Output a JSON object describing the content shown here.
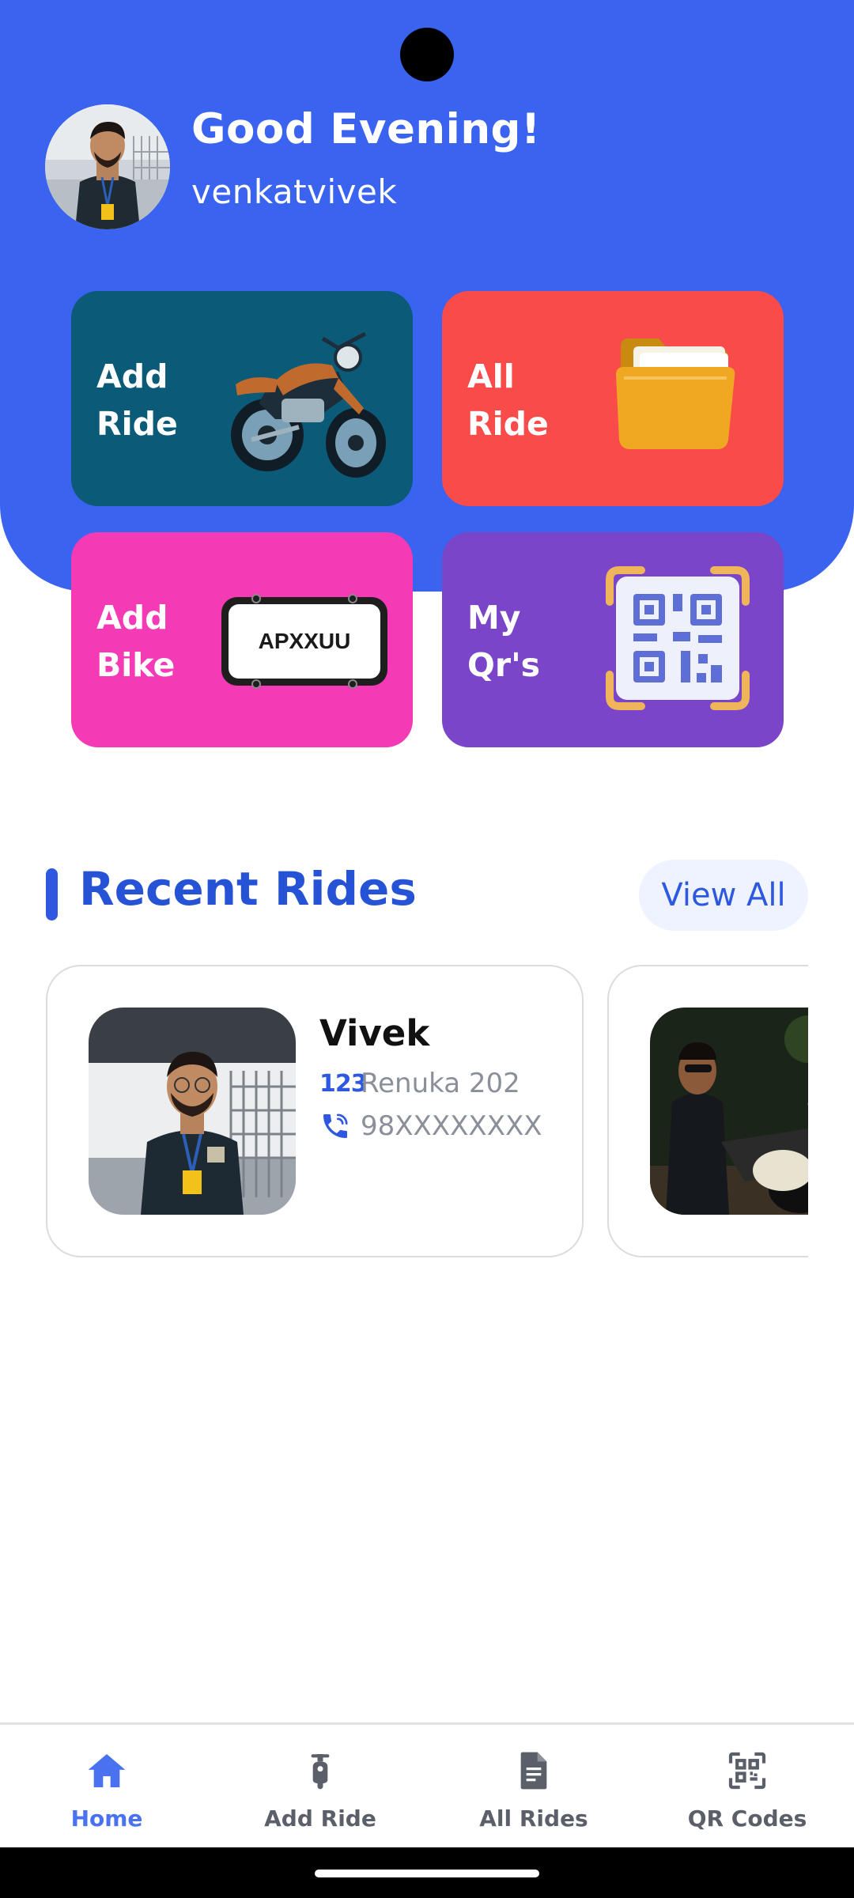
{
  "header": {
    "greeting": "Good Evening!",
    "username": "venkatvivek",
    "background_color": "#3a63f0"
  },
  "actions": [
    {
      "line1": "Add",
      "line2": "Ride",
      "color": "#0a5a78",
      "icon": "motorcycle-illustration"
    },
    {
      "line1": "All",
      "line2": "Ride",
      "color": "#fa4b4b",
      "icon": "folder-illustration"
    },
    {
      "line1": "Add",
      "line2": "Bike",
      "color": "#f43ab5",
      "icon": "license-plate-illustration",
      "plate_text": "APXXUU"
    },
    {
      "line1": "My",
      "line2": "Qr's",
      "color": "#7a45c8",
      "icon": "qr-code-illustration"
    }
  ],
  "recent_rides": {
    "title": "Recent Rides",
    "view_all_label": "View All",
    "rides": [
      {
        "name": "Vivek",
        "vehicle": "Renuka 202",
        "phone": "98XXXXXXXX",
        "vehicle_icon": "number-icon",
        "phone_icon": "phone-icon"
      },
      {
        "name": "",
        "vehicle": "",
        "phone": ""
      }
    ]
  },
  "bottom_nav": [
    {
      "label": "Home",
      "icon": "home-icon",
      "active": true
    },
    {
      "label": "Add Ride",
      "icon": "scooter-icon",
      "active": false
    },
    {
      "label": "All Rides",
      "icon": "document-icon",
      "active": false
    },
    {
      "label": "QR Codes",
      "icon": "qr-scan-icon",
      "active": false
    }
  ],
  "colors": {
    "accent": "#2e58e0",
    "nav_active": "#4a72f0",
    "nav_inactive": "#5b5f6a"
  }
}
